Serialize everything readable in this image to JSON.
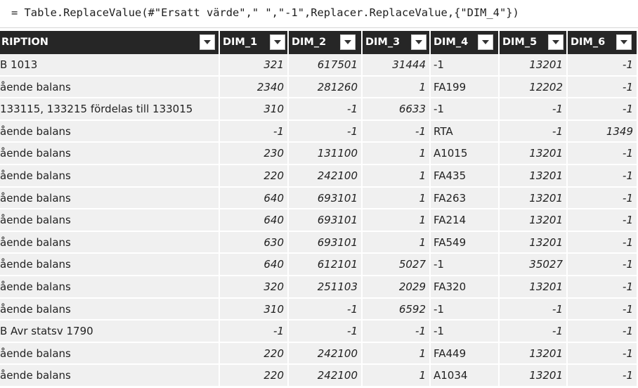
{
  "formula": "= Table.ReplaceValue(#\"Ersatt värde\",\" \",\"-1\",Replacer.ReplaceValue,{\"DIM_4\"})",
  "columns": [
    {
      "label": "RIPTION",
      "type": "text"
    },
    {
      "label": "DIM_1",
      "type": "number"
    },
    {
      "label": "DIM_2",
      "type": "number"
    },
    {
      "label": "DIM_3",
      "type": "number"
    },
    {
      "label": "DIM_4",
      "type": "text"
    },
    {
      "label": "DIM_5",
      "type": "number"
    },
    {
      "label": "DIM_6",
      "type": "number"
    }
  ],
  "rows": [
    [
      "B 1013",
      "321",
      "617501",
      "31444",
      "-1",
      "13201",
      "-1"
    ],
    [
      "ående balans",
      "2340",
      "281260",
      "1",
      "FA199",
      "12202",
      "-1"
    ],
    [
      "133115, 133215 fördelas till 133015",
      "310",
      "-1",
      "6633",
      "-1",
      "-1",
      "-1"
    ],
    [
      "ående balans",
      "-1",
      "-1",
      "-1",
      "RTA",
      "-1",
      "1349"
    ],
    [
      "ående balans",
      "230",
      "131100",
      "1",
      "A1015",
      "13201",
      "-1"
    ],
    [
      "ående balans",
      "220",
      "242100",
      "1",
      "FA435",
      "13201",
      "-1"
    ],
    [
      "ående balans",
      "640",
      "693101",
      "1",
      "FA263",
      "13201",
      "-1"
    ],
    [
      "ående balans",
      "640",
      "693101",
      "1",
      "FA214",
      "13201",
      "-1"
    ],
    [
      "ående balans",
      "630",
      "693101",
      "1",
      "FA549",
      "13201",
      "-1"
    ],
    [
      "ående balans",
      "640",
      "612101",
      "5027",
      "-1",
      "35027",
      "-1"
    ],
    [
      "ående balans",
      "320",
      "251103",
      "2029",
      "FA320",
      "13201",
      "-1"
    ],
    [
      "ående balans",
      "310",
      "-1",
      "6592",
      "-1",
      "-1",
      "-1"
    ],
    [
      "B Avr statsv 1790",
      "-1",
      "-1",
      "-1",
      "-1",
      "-1",
      "-1"
    ],
    [
      "ående balans",
      "220",
      "242100",
      "1",
      "FA449",
      "13201",
      "-1"
    ],
    [
      "ående balans",
      "220",
      "242100",
      "1",
      "A1034",
      "13201",
      "-1"
    ]
  ]
}
